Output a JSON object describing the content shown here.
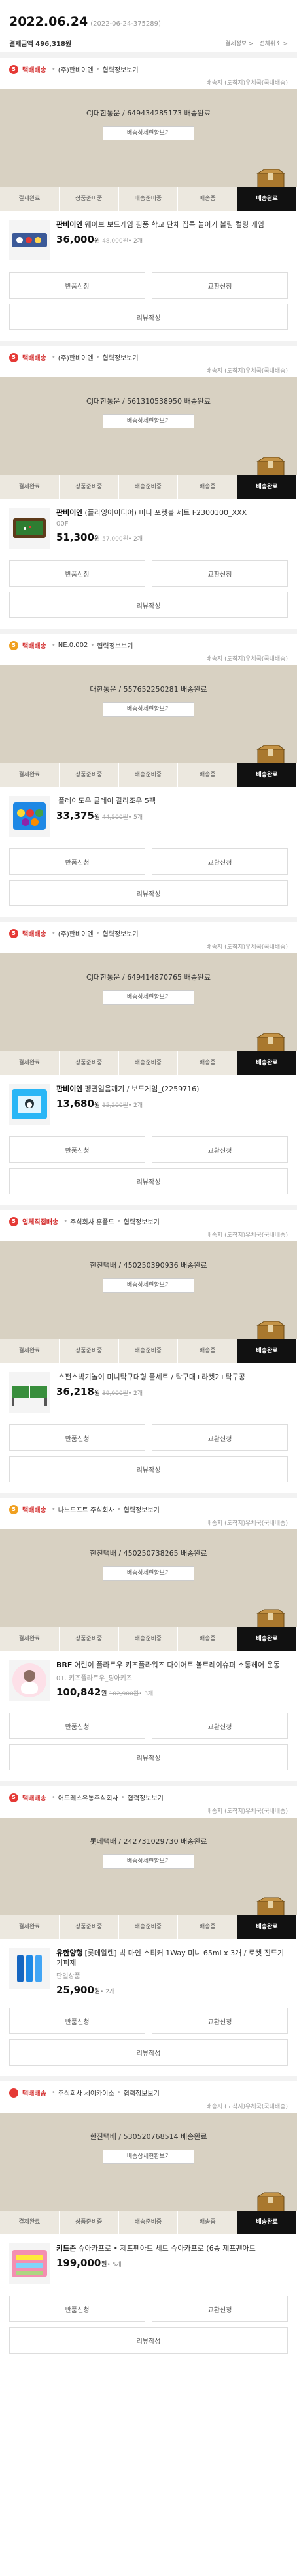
{
  "order": {
    "date": "2022.06.24",
    "order_no": "(2022-06-24-375289)",
    "amount_label": "결제금액 496,318원",
    "link_detail": "결제정보 >",
    "link_cancel": "전체취소 >"
  },
  "steps": [
    "결제완료",
    "상품준비중",
    "배송준비중",
    "배송중",
    "배송완료"
  ],
  "track_label": "배송상세현황보기",
  "ship_fee": "배송지 (도착지)우체국(국내배송)",
  "actions": {
    "return": "반품신청",
    "exchange": "교환신청",
    "review": "리뷰작성"
  },
  "shipments": [
    {
      "badge": "5",
      "type": "택배배송",
      "seller": "(주)판비이엔",
      "seller_link": "협력정보보기",
      "carrier": "CJ대한통운 / 649434285173 배송완료",
      "item_name": "웨이브 보드게임 핑퐁 학교 단체 집콕 놀이기 볼링 컬링 게임",
      "item_brand": "판비이엔",
      "option": "",
      "price": "36,000",
      "orig": "48,000원",
      "qty": "• 2개"
    },
    {
      "badge": "5",
      "type": "택배배송",
      "seller": "(주)판비이엔",
      "seller_link": "협력정보보기",
      "carrier": "CJ대한통운 / 561310538950 배송완료",
      "item_name": "(플라잉아이디어) 미니 포켓볼 세트 F2300100_XXX",
      "item_brand": "판비이엔",
      "option": "00F",
      "price": "51,300",
      "orig": "57,000원",
      "qty": "• 2개"
    },
    {
      "badge": "5",
      "type": "택배배송",
      "seller": "NE.0.002",
      "seller_link": "협력정보보기",
      "carrier": "대한통운 / 557652250281 배송완료",
      "item_name": "플레이도우 클레이 칼라조우 5팩",
      "item_brand": "",
      "option": "",
      "price": "33,375",
      "orig": "44,500원",
      "qty": "• 5개"
    },
    {
      "badge": "5",
      "type": "택배배송",
      "seller": "(주)판비이엔",
      "seller_link": "협력정보보기",
      "carrier": "CJ대한통운 / 649414870765 배송완료",
      "item_name": "펭귄얼음깨기 / 보드게임_(2259716)",
      "item_brand": "판비이엔",
      "option": "",
      "price": "13,680",
      "orig": "15,200원",
      "qty": "• 2개"
    },
    {
      "badge": "5",
      "type": "업체직접배송",
      "seller": "주식회사 훈풀드",
      "seller_link": "협력정보보기",
      "carrier": "한진택배 / 450250390936 배송완료",
      "item_name": "스펀스박기놀이 미니탁구대형 풀세트 / 탁구대+라켓2+탁구공",
      "item_brand": "",
      "option": "",
      "price": "36,218",
      "orig": "39,000원",
      "qty": "• 2개"
    },
    {
      "badge": "5",
      "type": "택배배송",
      "seller": "나노드프트 주식회사",
      "seller_link": "협력정보보기",
      "carrier": "한진택배 / 450250738265 배송완료",
      "item_name": "어린이 플라토우 키즈플라워즈 다이어트 볼트레이슈퍼 소통헤어 운동",
      "item_brand": "BRF",
      "option": "01. 키즈플라토우_핑아키즈",
      "price": "100,842",
      "orig": "102,900원",
      "qty": "• 3개"
    },
    {
      "badge": "5",
      "type": "택배배송",
      "seller": "어드레스유통주식회사",
      "seller_link": "협력정보보기",
      "carrier": "롯데택배 / 242731029730 배송완료",
      "item_name": "[롯데알렌] 빅 마인 스티커 1Way 미니 65ml x 3개 / 로켓 진드기 기피제",
      "item_brand": "유한양행",
      "option": "단일상품",
      "price": "25,900",
      "orig": "",
      "qty": "• 2개"
    },
    {
      "badge": "",
      "type": "택배배송",
      "seller": "주식회사 세이카이소",
      "seller_link": "협력정보보기",
      "carrier": "한진택배 / 530520768514 배송완료",
      "item_name": "슈아카프로 • 제프펜아트 세트 슈아카프로 (6종 제프펜아트",
      "item_brand": "키드존",
      "option": "",
      "price": "199,000",
      "orig": "",
      "qty": "• 5개"
    }
  ],
  "colors": {
    "panel": "#d8d1c2",
    "accent": "#e53935",
    "active_step": "#111111"
  }
}
